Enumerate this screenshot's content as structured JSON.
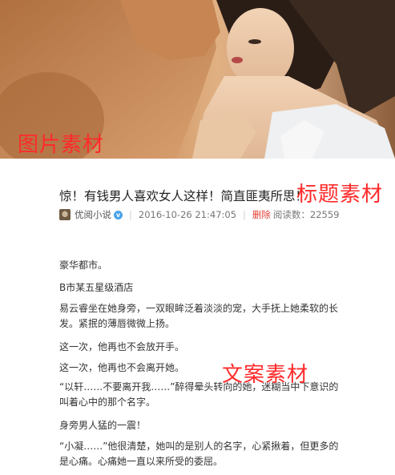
{
  "overlays": {
    "image_label": "图片素材",
    "title_label": "标题素材",
    "text_label": "文案素材"
  },
  "article": {
    "title": "惊！有钱男人喜欢女人这样！简直匪夷所思！",
    "author": "优阅小说",
    "verified_badge": "v",
    "date": "2016-10-26 21:47:05",
    "delete_label": "删除",
    "reads_label": "阅读数：22559",
    "paragraphs": [
      "豪华都市。",
      "B市某五星级酒店",
      "易云睿坐在她身旁，一双眼眸泛着淡淡的宠，大手抚上她柔软的长发。紧抿的薄唇微微上扬。",
      "这一次，他再也不会放开手。",
      "这一次，他再也不会离开她。",
      "“以轩……不要离开我……”醉得晕头转向的她，迷糊当中下意识的叫着心中的那个名字。",
      "身旁男人猛的一震！",
      "“小凝……”他很清楚，她叫的是别人的名字，心紧揪着，但更多的是心痛。心痛她一直以来所受的委屈。"
    ]
  },
  "colors": {
    "overlay_red": "#ff2a2a",
    "delete_red": "#e33e33",
    "badge_blue": "#4aa3e8"
  }
}
